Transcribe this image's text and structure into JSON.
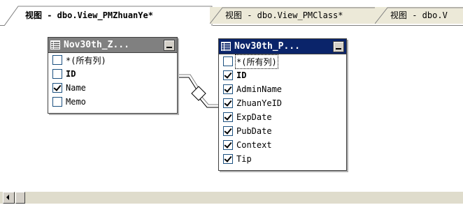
{
  "tabs": [
    {
      "label": "视图 - dbo.View_PMZhuanYe*",
      "active": true
    },
    {
      "label": "视图 - dbo.View_PMClass*",
      "active": false
    },
    {
      "label": "视图 - dbo.V",
      "active": false
    }
  ],
  "tables": [
    {
      "title": "Nov30th_Z...",
      "state": "inactive",
      "columns": [
        {
          "name": "*(所有列)",
          "checked": false,
          "bold": false
        },
        {
          "name": "ID",
          "checked": false,
          "bold": true
        },
        {
          "name": "Name",
          "checked": true,
          "bold": false
        },
        {
          "name": "Memo",
          "checked": false,
          "bold": false
        }
      ]
    },
    {
      "title": "Nov30th_P...",
      "state": "active",
      "columns": [
        {
          "name": "*(所有列)",
          "checked": false,
          "bold": false,
          "focused": true
        },
        {
          "name": "ID",
          "checked": true,
          "bold": true
        },
        {
          "name": "AdminName",
          "checked": true,
          "bold": false
        },
        {
          "name": "ZhuanYeID",
          "checked": true,
          "bold": false
        },
        {
          "name": "ExpDate",
          "checked": true,
          "bold": false
        },
        {
          "name": "PubDate",
          "checked": true,
          "bold": false
        },
        {
          "name": "Context",
          "checked": true,
          "bold": false
        },
        {
          "name": "Tip",
          "checked": true,
          "bold": false
        }
      ]
    }
  ],
  "icons": {
    "table": "table-grid-icon",
    "minimize": "minimize-icon",
    "join": "join-diamond-icon",
    "scroll_left": "scroll-left-arrow-icon"
  },
  "colors": {
    "active_title": "#0a246a",
    "inactive_title": "#808080",
    "checkbox_border": "#1c5180",
    "tab_bg": "#ece9d8"
  }
}
